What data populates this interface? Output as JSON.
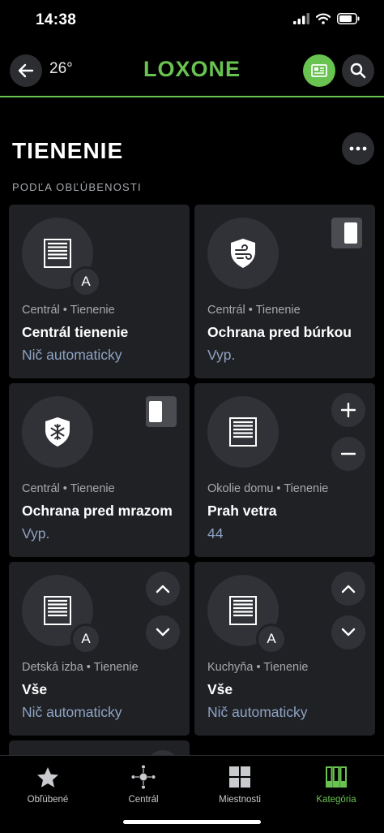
{
  "status_bar": {
    "time": "14:38"
  },
  "header": {
    "temperature": "26°",
    "logo": "LOXONE",
    "accent": "#69c350"
  },
  "page": {
    "title": "TIENENIE",
    "section": "PODĽA OBĽÚBENOSTI"
  },
  "cards": [
    {
      "icon": "blinds-icon",
      "auto_badge": "A",
      "subtitle": "Centrál • Tienenie",
      "title": "Centrál tienenie",
      "status": "Nič automaticky"
    },
    {
      "icon": "wind-shield-icon",
      "subtitle": "Centrál • Tienenie",
      "title": "Ochrana pred búrkou",
      "status": "Vyp."
    },
    {
      "icon": "frost-shield-icon",
      "subtitle": "Centrál • Tienenie",
      "title": "Ochrana pred mrazom",
      "status": "Vyp."
    },
    {
      "icon": "blinds-icon",
      "subtitle": "Okolie domu • Tienenie",
      "title": "Prah vetra",
      "status": "44"
    },
    {
      "icon": "blinds-icon",
      "auto_badge": "A",
      "subtitle": "Detská izba • Tienenie",
      "title": "Vše",
      "status": "Nič automaticky"
    },
    {
      "icon": "blinds-icon",
      "auto_badge": "A",
      "subtitle": "Kuchyňa • Tienenie",
      "title": "Vše",
      "status": "Nič automaticky"
    }
  ],
  "tabs": [
    {
      "label": "Obľúbené",
      "icon": "star-icon"
    },
    {
      "label": "Centrál",
      "icon": "central-hub-icon"
    },
    {
      "label": "Miestnosti",
      "icon": "rooms-grid-icon"
    },
    {
      "label": "Kategória",
      "icon": "category-icon",
      "active": true
    }
  ],
  "colors": {
    "background": "#000000",
    "card": "#1f2125",
    "status_text": "#8ea3c3",
    "subtitle": "#a7a9ad"
  }
}
